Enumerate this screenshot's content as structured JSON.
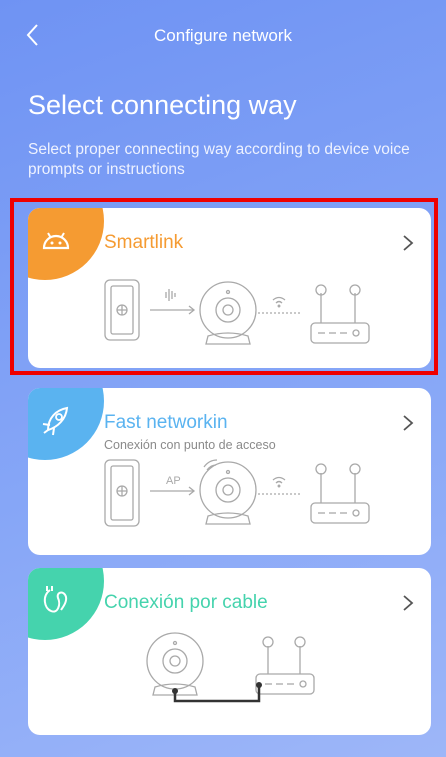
{
  "header": {
    "title": "Configure network"
  },
  "main": {
    "heading": "Select connecting way",
    "subtitle": "Select proper connecting way according to device voice prompts or instructions"
  },
  "cards": [
    {
      "name": "Smartlink",
      "subtitle": "",
      "accent": "#f59b32",
      "icon": "android-icon"
    },
    {
      "name": "Fast networkin",
      "subtitle": "Conexión con punto de acceso",
      "ap_label": "AP",
      "accent": "#5ab3f0",
      "icon": "rocket-icon"
    },
    {
      "name": "Conexión por cable",
      "subtitle": "",
      "accent": "#45d3ad",
      "icon": "cable-plug-icon"
    }
  ],
  "colors": {
    "background": "#7f9ff6",
    "selection": "#ee0000",
    "line_art": "#a9a9a9"
  }
}
